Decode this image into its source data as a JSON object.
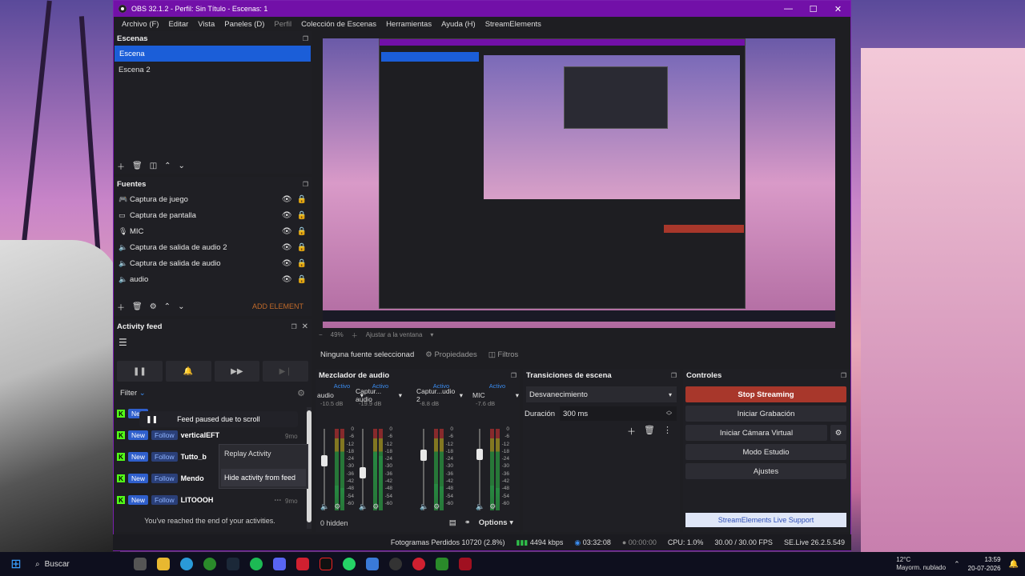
{
  "window": {
    "title": "OBS 32.1.2 - Perfil: Sin Título - Escenas: 1",
    "controls": [
      "—",
      "☐",
      "✕"
    ]
  },
  "menu": [
    "Archivo (F)",
    "Editar",
    "Vista",
    "Paneles (D)",
    "Perfil",
    "Colección de Escenas",
    "Herramientas",
    "Ayuda (H)",
    "StreamElements"
  ],
  "scenes": {
    "title": "Escenas",
    "items": [
      "Escena",
      "Escena 2"
    ]
  },
  "sources": {
    "title": "Fuentes",
    "items": [
      {
        "name": "Captura de juego",
        "icon": "gamepad-icon"
      },
      {
        "name": "Captura de pantalla",
        "icon": "monitor-icon"
      },
      {
        "name": "MIC",
        "icon": "mic-icon"
      },
      {
        "name": "Captura de salida de audio 2",
        "icon": "speaker-icon"
      },
      {
        "name": "Captura de salida de audio",
        "icon": "speaker-icon"
      },
      {
        "name": "audio",
        "icon": "speaker-icon"
      }
    ],
    "add_element": "ADD ELEMENT"
  },
  "activity": {
    "title": "Activity feed",
    "filter": "Filter",
    "paused_msg": "Feed paused due to scroll",
    "rows": [
      {
        "name": "",
        "time": "9mo"
      },
      {
        "name": "verticalEFT",
        "time": "9mo"
      },
      {
        "name": "Tutto_b",
        "time": "9mo"
      },
      {
        "name": "Mendo",
        "time": "9mo"
      },
      {
        "name": "LITOOOH",
        "time": "9mo"
      }
    ],
    "badge_new": "New",
    "badge_follow": "Follow",
    "menu_replay": "Replay Activity",
    "menu_hide": "Hide activity from feed",
    "end_msg": "You've reached the end of your activities."
  },
  "context_bar": {
    "no_source": "Ninguna fuente seleccionad",
    "properties": "Propiedades",
    "filters": "Filtros"
  },
  "mixer": {
    "title": "Mezclador de audio",
    "channels": [
      {
        "state": "Activo",
        "name": "audio",
        "db": "-10.5 dB",
        "level": 0.3,
        "fader": 0.62
      },
      {
        "state": "Activo",
        "name": "Captur... audio",
        "db": "-19.9 dB",
        "level": 0.72,
        "fader": 0.45
      },
      {
        "state": "Activo",
        "name": "Captur...udio 2",
        "db": "-8.8 dB",
        "level": 0.32,
        "fader": 0.7
      },
      {
        "state": "Activo",
        "name": "MIC",
        "db": "-7.6 dB",
        "level": 0.3,
        "fader": 0.72
      }
    ],
    "scale": [
      "0",
      "-6",
      "-12",
      "-18",
      "-24",
      "-30",
      "-36",
      "-42",
      "-48",
      "-54",
      "-60"
    ],
    "hidden": "0 hidden",
    "options": "Options"
  },
  "transitions": {
    "title": "Transiciones de escena",
    "selected": "Desvanecimiento",
    "duration_label": "Duración",
    "duration_value": "300 ms"
  },
  "controls": {
    "title": "Controles",
    "stop_streaming": "Stop Streaming",
    "start_recording": "Iniciar Grabación",
    "virtual_cam": "Iniciar Cámara Virtual",
    "studio_mode": "Modo Estudio",
    "settings": "Ajustes",
    "se_support": "StreamElements Live Support"
  },
  "status": {
    "dropped": "Fotogramas Perdidos 10720 (2.8%)",
    "bitrate": "4494 kbps",
    "stream_time": "03:32:08",
    "rec_time": "00:00:00",
    "cpu": "CPU: 1.0%",
    "fps": "30.00 / 30.00 FPS",
    "se_version": "SE.Live 26.2.5.549"
  },
  "preview_zoom": {
    "zoom": "49%",
    "fit": "Ajustar a la ventana"
  },
  "taskbar": {
    "search": "Buscar",
    "temp": "12°C",
    "weather": "Mayorm. nublado",
    "time": "13:59",
    "date": "20-07-2026"
  }
}
